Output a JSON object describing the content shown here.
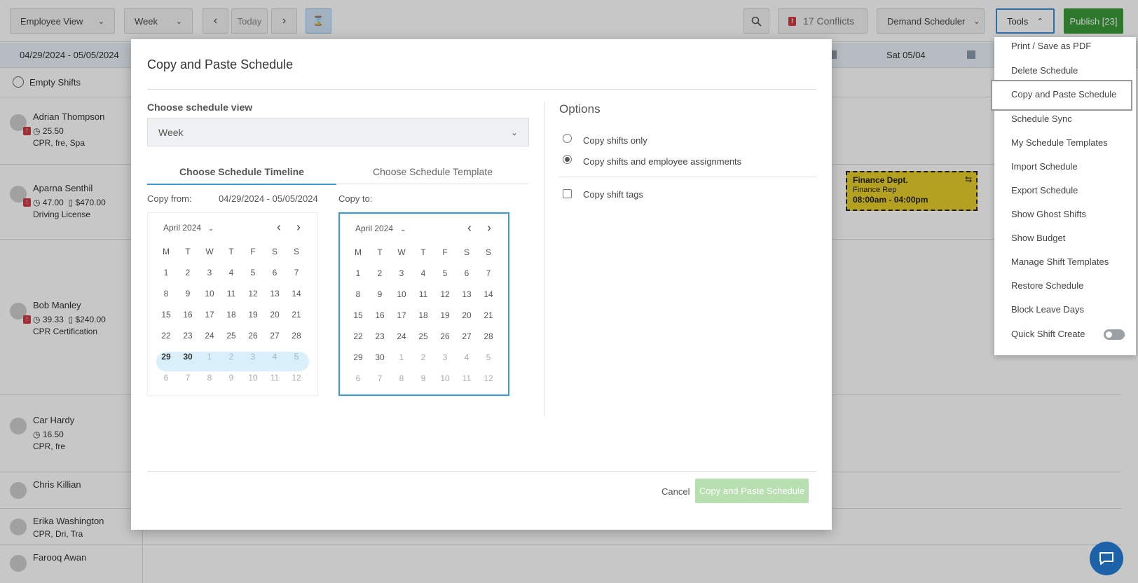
{
  "toolbar": {
    "view_select": "Employee View",
    "range_select": "Week",
    "prev_icon": "chevron-left-icon",
    "today": "Today",
    "next_icon": "chevron-right-icon",
    "hourglass_icon": "hourglass-icon",
    "search_icon": "search-icon",
    "conflicts": "17 Conflicts",
    "demand_scheduler": "Demand Scheduler",
    "tools": "Tools",
    "publish": "Publish [23]"
  },
  "subbar": {
    "date_range": "04/29/2024 - 05/05/2024",
    "sat_label": "Sat 05/04"
  },
  "grid": {
    "empty_shifts": "Empty Shifts",
    "employees": [
      {
        "name": "Adrian Thompson",
        "line1": "25.50",
        "line2": "CPR, fre, Spa",
        "alert": true
      },
      {
        "name": "Aparna Senthil",
        "line1": "47.00",
        "budget": "$470.00",
        "line2": "Driving License",
        "alert": true
      },
      {
        "name": "Bob Manley",
        "line1": "39.33",
        "budget": "$240.00",
        "line2": "CPR Certification",
        "alert": true
      },
      {
        "name": "Car Hardy",
        "line1": "16.50",
        "line2": "CPR, fre",
        "alert": false
      },
      {
        "name": "Chris Killian",
        "line1": "",
        "line2": "",
        "alert": false
      },
      {
        "name": "Erika Washington",
        "line1": "CPR, Dri, Tra",
        "line2": "",
        "alert": false
      },
      {
        "name": "Farooq Awan",
        "line1": "",
        "line2": "",
        "alert": false
      }
    ],
    "shift": {
      "dept": "Finance Dept.",
      "role": "Finance Rep",
      "time": "08:00am - 04:00pm"
    }
  },
  "modal": {
    "title": "Copy and Paste Schedule",
    "view_label": "Choose schedule view",
    "view_value": "Week",
    "tab_timeline": "Choose Schedule Timeline",
    "tab_template": "Choose Schedule Template",
    "copy_from_label": "Copy from:",
    "copy_from_value": "04/29/2024 - 05/05/2024",
    "copy_to_label": "Copy to:",
    "calendar_from": {
      "month": "April 2024",
      "dow": [
        "M",
        "T",
        "W",
        "T",
        "F",
        "S",
        "S"
      ],
      "weeks": [
        [
          "1",
          "2",
          "3",
          "4",
          "5",
          "6",
          "7"
        ],
        [
          "8",
          "9",
          "10",
          "11",
          "12",
          "13",
          "14"
        ],
        [
          "15",
          "16",
          "17",
          "18",
          "19",
          "20",
          "21"
        ],
        [
          "22",
          "23",
          "24",
          "25",
          "26",
          "27",
          "28"
        ],
        [
          "29",
          "30",
          "1",
          "2",
          "3",
          "4",
          "5"
        ],
        [
          "6",
          "7",
          "8",
          "9",
          "10",
          "11",
          "12"
        ]
      ]
    },
    "calendar_to": {
      "month": "April 2024",
      "dow": [
        "M",
        "T",
        "W",
        "T",
        "F",
        "S",
        "S"
      ],
      "weeks": [
        [
          "1",
          "2",
          "3",
          "4",
          "5",
          "6",
          "7"
        ],
        [
          "8",
          "9",
          "10",
          "11",
          "12",
          "13",
          "14"
        ],
        [
          "15",
          "16",
          "17",
          "18",
          "19",
          "20",
          "21"
        ],
        [
          "22",
          "23",
          "24",
          "25",
          "26",
          "27",
          "28"
        ],
        [
          "29",
          "30",
          "1",
          "2",
          "3",
          "4",
          "5"
        ],
        [
          "6",
          "7",
          "8",
          "9",
          "10",
          "11",
          "12"
        ]
      ]
    },
    "options_title": "Options",
    "opt_shifts_only": "Copy shifts only",
    "opt_shifts_assign": "Copy shifts and employee assignments",
    "opt_tags": "Copy shift tags",
    "cancel": "Cancel",
    "submit": "Copy and Paste Schedule"
  },
  "tools_menu": {
    "items": [
      "Print / Save as PDF",
      "Delete Schedule",
      "Copy and Paste Schedule",
      "Schedule Sync",
      "My Schedule Templates",
      "Import Schedule",
      "Export Schedule",
      "Show Ghost Shifts",
      "Show Budget",
      "Manage Shift Templates",
      "Restore Schedule",
      "Block Leave Days",
      "Quick Shift Create"
    ]
  },
  "colors": {
    "accent": "#3b9ad9",
    "publish": "#3a9a3a",
    "alert": "#d9363e",
    "shift_fill": "#e7cf2a",
    "submit_disabled": "#b7dfb0"
  }
}
